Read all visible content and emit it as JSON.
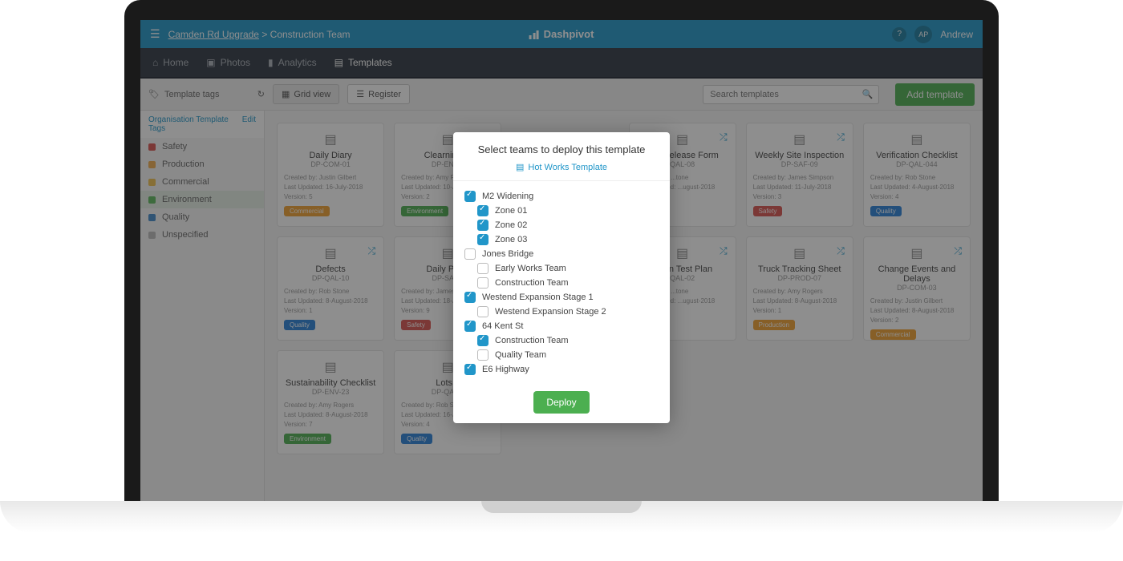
{
  "header": {
    "breadcrumb_project": "Camden Rd Upgrade",
    "breadcrumb_team": "Construction Team",
    "app_name": "Dashpivot",
    "user_initials": "AP",
    "user_name": "Andrew"
  },
  "nav": {
    "home": "Home",
    "photos": "Photos",
    "analytics": "Analytics",
    "templates": "Templates"
  },
  "toolbar": {
    "tags_label": "Template tags",
    "grid_view": "Grid view",
    "register": "Register",
    "search_placeholder": "Search templates",
    "add_template": "Add template"
  },
  "sidebar": {
    "org_tags": "Organisation Template Tags",
    "edit": "Edit",
    "tags": [
      {
        "label": "Safety",
        "color": "#d9534f"
      },
      {
        "label": "Production",
        "color": "#f0ad4e"
      },
      {
        "label": "Commercial",
        "color": "#f0c04e"
      },
      {
        "label": "Environment",
        "color": "#5cb85c"
      },
      {
        "label": "Quality",
        "color": "#428bca"
      },
      {
        "label": "Unspecified",
        "color": "#bbb"
      }
    ]
  },
  "modal": {
    "title": "Select teams to deploy this template",
    "template_name": "Hot Works Template",
    "deploy": "Deploy",
    "tree": [
      {
        "label": "M2 Widening",
        "level": 0,
        "checked": true
      },
      {
        "label": "Zone 01",
        "level": 1,
        "checked": true
      },
      {
        "label": "Zone 02",
        "level": 1,
        "checked": true
      },
      {
        "label": "Zone 03",
        "level": 1,
        "checked": true
      },
      {
        "label": "Jones Bridge",
        "level": 0,
        "checked": false
      },
      {
        "label": "Early Works Team",
        "level": 1,
        "checked": false
      },
      {
        "label": "Construction Team",
        "level": 1,
        "checked": false
      },
      {
        "label": "Westend Expansion Stage 1",
        "level": 0,
        "checked": true
      },
      {
        "label": "Westend Expansion Stage 2",
        "level": 1,
        "checked": false
      },
      {
        "label": "64 Kent St",
        "level": 0,
        "checked": true
      },
      {
        "label": "Construction Team",
        "level": 1,
        "checked": true
      },
      {
        "label": "Quality Team",
        "level": 1,
        "checked": false
      },
      {
        "label": "E6 Highway",
        "level": 0,
        "checked": true
      }
    ]
  },
  "tag_colors": {
    "Commercial": "#f0a030",
    "Environment": "#4caf50",
    "Safety": "#d9534f",
    "Quality": "#2980d9",
    "Production": "#f0a030"
  },
  "cards": [
    {
      "title": "Daily Diary",
      "code": "DP-COM-01",
      "created": "Justin Gilbert",
      "updated": "16-July-2018",
      "version": "5",
      "tag": "Commercial",
      "shuffle": false
    },
    {
      "title": "Clearning ...",
      "code": "DP-ENV...",
      "created": "Amy Rogers",
      "updated": "10-July-2018",
      "version": "2",
      "tag": "Environment",
      "shuffle": false
    },
    {
      "title": "",
      "code": "",
      "created": "",
      "updated": "",
      "version": "",
      "tag": "",
      "shuffle": true,
      "hidden": true
    },
    {
      "title": "...nt Release Form",
      "code": "QAL-08",
      "created": "...tone",
      "updated": "...ugust-2018",
      "version": "",
      "tag": "",
      "shuffle": true
    },
    {
      "title": "Weekly Site Inspection",
      "code": "DP-SAF-09",
      "created": "James Simpson",
      "updated": "11-July-2018",
      "version": "3",
      "tag": "Safety",
      "shuffle": true
    },
    {
      "title": "Verification Checklist",
      "code": "DP-QAL-044",
      "created": "Rob Stone",
      "updated": "4-August-2018",
      "version": "4",
      "tag": "Quality",
      "shuffle": false
    },
    {
      "title": "Defects",
      "code": "DP-QAL-10",
      "created": "Rob Stone",
      "updated": "8-August-2018",
      "version": "1",
      "tag": "Quality",
      "shuffle": true
    },
    {
      "title": "Daily Pre...",
      "code": "DP-SAF...",
      "created": "James Simp...",
      "updated": "18-July-2018",
      "version": "9",
      "tag": "Safety",
      "shuffle": false
    },
    {
      "title": "",
      "code": "",
      "created": "",
      "updated": "",
      "version": "",
      "tag": "",
      "shuffle": true,
      "hidden": true
    },
    {
      "title": "...tion Test Plan",
      "code": "QAL-02",
      "created": "...tone",
      "updated": "...ugust-2018",
      "version": "",
      "tag": "",
      "shuffle": true
    },
    {
      "title": "Truck Tracking Sheet",
      "code": "DP-PROD-07",
      "created": "Amy Rogers",
      "updated": "8-August-2018",
      "version": "1",
      "tag": "Production",
      "shuffle": true
    },
    {
      "title": "Change Events and Delays",
      "code": "DP-COM-03",
      "created": "Justin Gilbert",
      "updated": "8-August-2018",
      "version": "2",
      "tag": "Commercial",
      "shuffle": true
    },
    {
      "title": "Sustainability Checklist",
      "code": "DP-ENV-23",
      "created": "Amy Rogers",
      "updated": "8-August-2018",
      "version": "7",
      "tag": "Environment",
      "shuffle": false
    },
    {
      "title": "Lots...",
      "code": "DP-QAL...",
      "created": "Rob Stone",
      "updated": "16-July-2018",
      "version": "4",
      "tag": "Quality",
      "shuffle": false
    }
  ]
}
